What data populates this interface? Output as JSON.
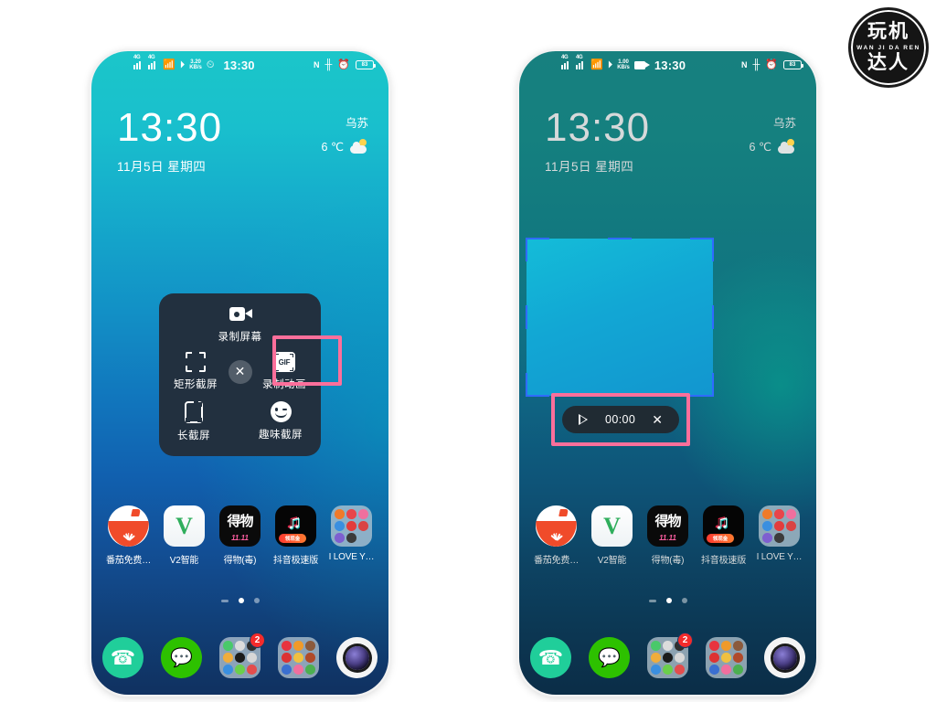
{
  "watermark": {
    "line1": "玩机",
    "line2": "WAN JI DA REN",
    "line3": "达人",
    "name": "wanjidaren-logo"
  },
  "phones": [
    {
      "id": "phone-left",
      "label": "screenshot-menu-phone",
      "status_bar": {
        "network_1": "4G",
        "network_2": "4G",
        "wifi_icon": "wifi-icon",
        "vpn_icon": "vpn-icon",
        "net_speed_value": "3.20",
        "net_speed_unit": "KB/s",
        "alarm_icon": "alarm-icon",
        "clock": "13:30",
        "nfc": "N",
        "bluetooth_icon": "bluetooth-icon",
        "clock_badge_icon": "clock-icon",
        "battery_level": "83"
      },
      "clock_widget": {
        "time": "13:30",
        "date": "11月5日 星期四",
        "city": "乌苏",
        "temperature": "6 ℃",
        "weather_icon": "sun-cloud-icon"
      },
      "popup": {
        "name": "screenshot-tools-popup",
        "items": [
          {
            "label": "录制屏幕",
            "icon": "camcorder-icon",
            "name": "record-screen"
          },
          {
            "label": "矩形截屏",
            "icon": "rect-crop-icon",
            "name": "rect-screenshot"
          },
          {
            "label": "录制动画",
            "icon": "gif-icon",
            "name": "record-gif",
            "highlighted": true
          },
          {
            "label": "长截屏",
            "icon": "long-screenshot-icon",
            "name": "long-screenshot"
          },
          {
            "label": "趣味截屏",
            "icon": "smiley-icon",
            "name": "fun-screenshot"
          }
        ],
        "close_label": "✕"
      },
      "apps": [
        {
          "label": "番茄免费…",
          "icon": "tomato-novel-icon"
        },
        {
          "label": "V2智能",
          "icon": "v2-smart-icon"
        },
        {
          "label": "得物(毒)",
          "icon": "dewu-icon",
          "icon_text": "得物",
          "icon_sub": "11.11"
        },
        {
          "label": "抖音极速版",
          "icon": "douyin-lite-icon",
          "badge_text": "领现金"
        },
        {
          "label": "I LOVE Y…",
          "icon": "folder-icon"
        }
      ],
      "page_dots": {
        "count": 3,
        "active_index": 1
      },
      "dock": [
        {
          "name": "phone-dialer",
          "icon": "phone-icon"
        },
        {
          "name": "wechat",
          "icon": "wechat-icon"
        },
        {
          "name": "folder-tools",
          "icon": "folder-icon",
          "badge": "2"
        },
        {
          "name": "folder-games",
          "icon": "folder-icon"
        },
        {
          "name": "camera",
          "icon": "camera-icon"
        }
      ]
    },
    {
      "id": "phone-right",
      "label": "gif-recording-phone",
      "status_bar": {
        "network_1": "4G",
        "network_2": "4G",
        "wifi_icon": "wifi-icon",
        "vpn_icon": "vpn-icon",
        "net_speed_value": "1.00",
        "net_speed_unit": "KB/s",
        "recording_icon": "recording-camcorder-icon",
        "clock": "13:30",
        "nfc": "N",
        "bluetooth_icon": "bluetooth-icon",
        "clock_badge_icon": "clock-icon",
        "battery_level": "83"
      },
      "clock_widget": {
        "time": "13:30",
        "date": "11月5日 星期四",
        "city": "乌苏",
        "temperature": "6 ℃",
        "weather_icon": "sun-cloud-icon"
      },
      "selection": {
        "name": "gif-capture-selection",
        "handle_color": "#2f6bff"
      },
      "recording_bar": {
        "name": "gif-recording-controls",
        "play_icon": "play-icon",
        "timer": "00:00",
        "close_label": "✕",
        "highlighted": true
      },
      "apps": [
        {
          "label": "番茄免费…",
          "icon": "tomato-novel-icon"
        },
        {
          "label": "V2智能",
          "icon": "v2-smart-icon"
        },
        {
          "label": "得物(毒)",
          "icon": "dewu-icon",
          "icon_text": "得物",
          "icon_sub": "11.11"
        },
        {
          "label": "抖音极速版",
          "icon": "douyin-lite-icon",
          "badge_text": "领现金"
        },
        {
          "label": "I LOVE Y…",
          "icon": "folder-icon"
        }
      ],
      "page_dots": {
        "count": 3,
        "active_index": 1
      },
      "dock": [
        {
          "name": "phone-dialer",
          "icon": "phone-icon"
        },
        {
          "name": "wechat",
          "icon": "wechat-icon"
        },
        {
          "name": "folder-tools",
          "icon": "folder-icon",
          "badge": "2"
        },
        {
          "name": "folder-games",
          "icon": "folder-icon"
        },
        {
          "name": "camera",
          "icon": "camera-icon"
        }
      ]
    }
  ],
  "colors": {
    "highlight": "#fc6f9b",
    "popup_bg": "#22303f",
    "selection_handle": "#2f6bff",
    "badge_red": "#f42b2b"
  }
}
